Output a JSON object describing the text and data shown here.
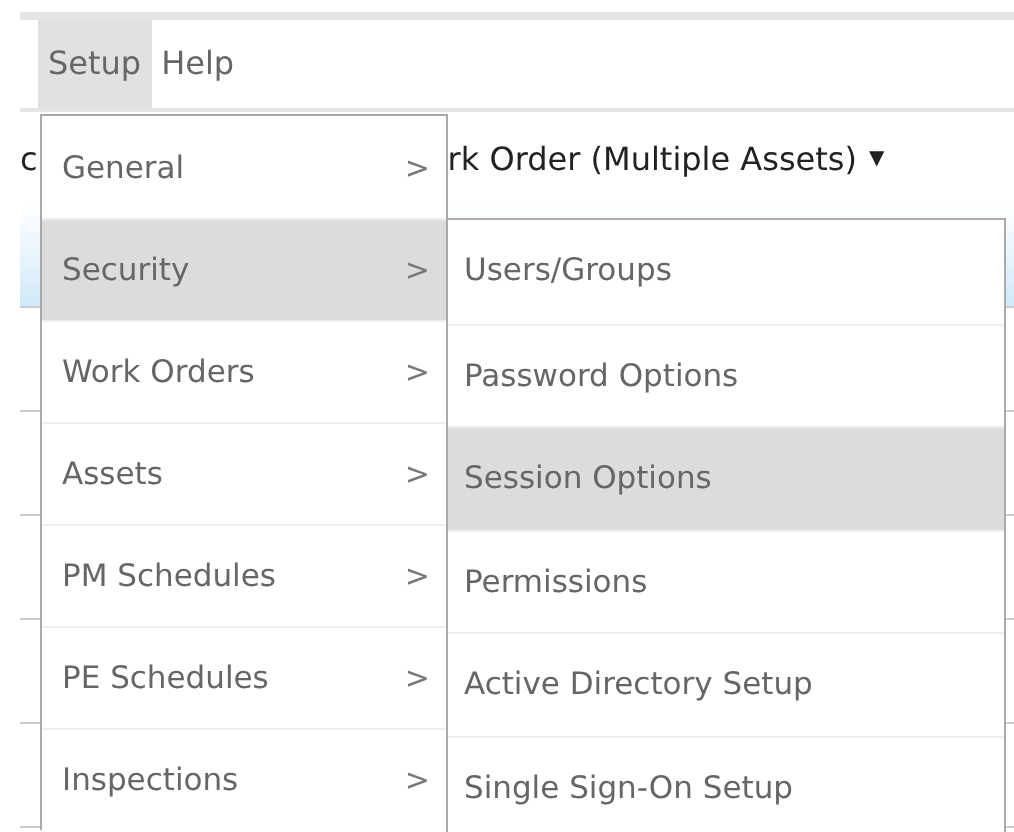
{
  "menubar": [
    {
      "label": "Setup",
      "selected": true
    },
    {
      "label": "Help",
      "selected": false
    }
  ],
  "background": {
    "left_text": "c",
    "title": "rk Order (Multiple Assets)",
    "caret": "▼"
  },
  "menu": [
    {
      "label": "General",
      "arrow": ">",
      "selected": false
    },
    {
      "label": "Security",
      "arrow": ">",
      "selected": true
    },
    {
      "label": "Work Orders",
      "arrow": ">",
      "selected": false
    },
    {
      "label": "Assets",
      "arrow": ">",
      "selected": false
    },
    {
      "label": "PM Schedules",
      "arrow": ">",
      "selected": false
    },
    {
      "label": "PE Schedules",
      "arrow": ">",
      "selected": false
    },
    {
      "label": "Inspections",
      "arrow": ">",
      "selected": false
    }
  ],
  "submenu": [
    {
      "label": "Users/Groups",
      "selected": false
    },
    {
      "label": "Password Options",
      "selected": false
    },
    {
      "label": "Session Options",
      "selected": true
    },
    {
      "label": "Permissions",
      "selected": false
    },
    {
      "label": "Active Directory Setup",
      "selected": false
    },
    {
      "label": "Single Sign-On Setup",
      "selected": false
    }
  ]
}
